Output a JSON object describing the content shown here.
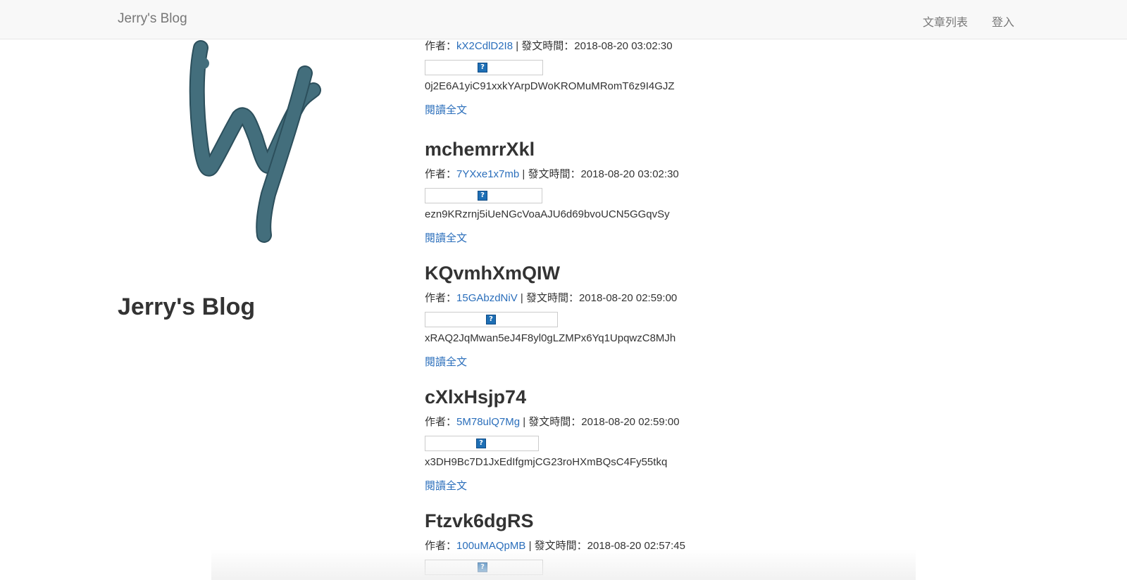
{
  "navbar": {
    "brand": "Jerry's Blog",
    "links": [
      "文章列表",
      "登入"
    ]
  },
  "sidebar": {
    "logo_icon": "handwritten-w-logo",
    "logo_color": "#436e7c",
    "title": "Jerry's Blog"
  },
  "posts": [
    {
      "title": "",
      "author_prefix": "作者：",
      "author": "kX2CdlD2I8",
      "date_prefix": " | 發文時間：",
      "date": "2018-08-20 03:02:30",
      "image_icon": "broken-image-icon",
      "image_icon_glyph": "?",
      "excerpt": "0j2E6A1yiC91xxkYArpDWoKROMuMRomT6z9I4GJZ",
      "read_more": "閱讀全文"
    },
    {
      "title": "mchemrrXkl",
      "author_prefix": "作者：",
      "author": "7YXxe1x7mb",
      "date_prefix": " | 發文時間：",
      "date": "2018-08-20 03:02:30",
      "image_icon": "broken-image-icon",
      "image_icon_glyph": "?",
      "excerpt": "ezn9KRzrnj5iUeNGcVoaAJU6d69bvoUCN5GGqvSy",
      "read_more": "閱讀全文"
    },
    {
      "title": "KQvmhXmQIW",
      "author_prefix": "作者：",
      "author": "15GAbzdNiV",
      "date_prefix": " | 發文時間：",
      "date": "2018-08-20 02:59:00",
      "image_icon": "broken-image-icon",
      "image_icon_glyph": "?",
      "excerpt": "xRAQ2JqMwan5eJ4F8yl0gLZMPx6Yq1UpqwzC8MJh",
      "read_more": "閱讀全文"
    },
    {
      "title": "cXlxHsjp74",
      "author_prefix": "作者：",
      "author": "5M78ulQ7Mg",
      "date_prefix": " | 發文時間：",
      "date": "2018-08-20 02:59:00",
      "image_icon": "broken-image-icon",
      "image_icon_glyph": "?",
      "excerpt": "x3DH9Bc7D1JxEdIfgmjCG23roHXmBQsC4Fy55tkq",
      "read_more": "閱讀全文"
    },
    {
      "title": "Ftzvk6dgRS",
      "author_prefix": "作者：",
      "author": "100uMAQpMB",
      "date_prefix": " | 發文時間：",
      "date": "2018-08-20 02:57:45",
      "image_icon": "broken-image-icon",
      "image_icon_glyph": "?",
      "excerpt": "",
      "read_more": ""
    }
  ]
}
